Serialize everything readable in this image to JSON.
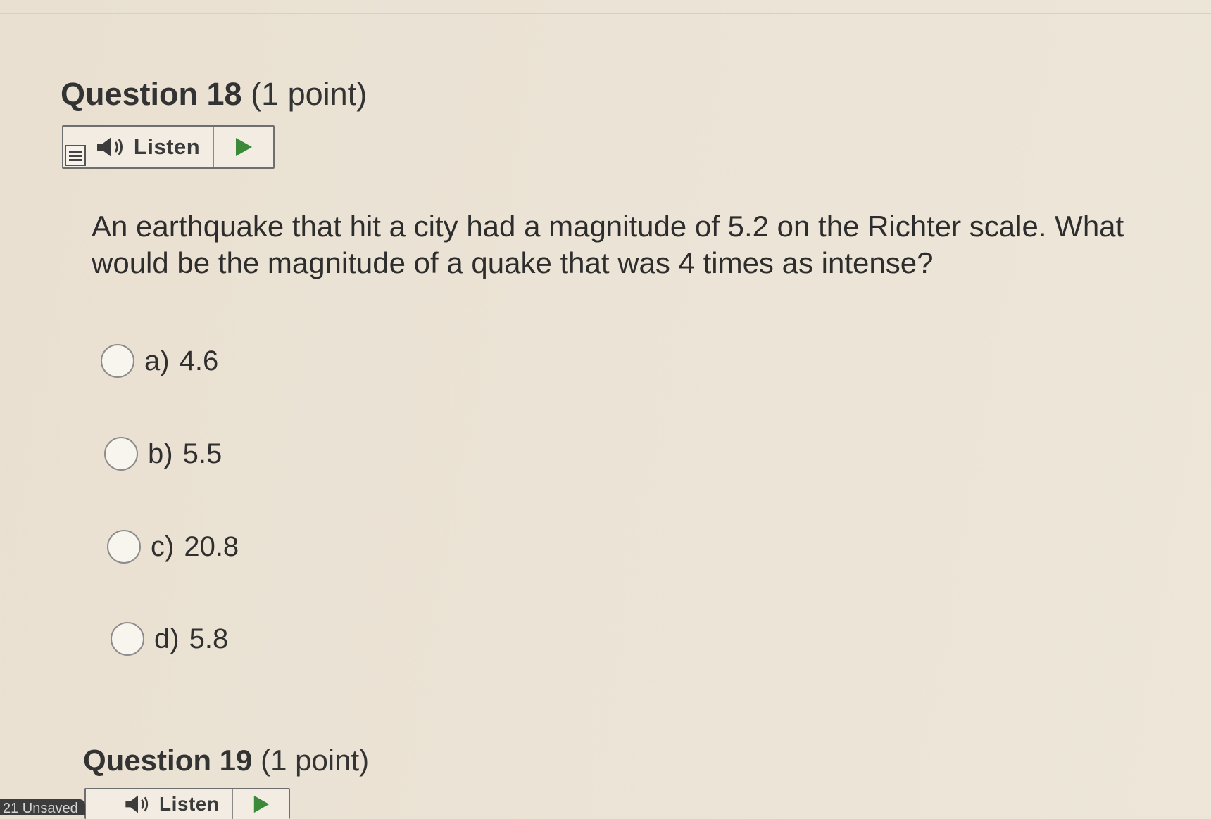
{
  "question18": {
    "number_label": "Question 18",
    "points_label": "(1 point)",
    "listen_label": "Listen",
    "prompt": "An earthquake that hit a city had a magnitude of 5.2 on the Richter scale. What would be the magnitude of a quake that was 4 times as intense?",
    "options": [
      {
        "letter": "a)",
        "value": "4.6"
      },
      {
        "letter": "b)",
        "value": "5.5"
      },
      {
        "letter": "c)",
        "value": "20.8"
      },
      {
        "letter": "d)",
        "value": "5.8"
      }
    ]
  },
  "question19": {
    "number_label": "Question 19",
    "points_label": "(1 point)",
    "listen_label": "Listen"
  },
  "bottom_tab": {
    "label": "21 Unsaved"
  },
  "colors": {
    "play_icon": "#3a8a3a",
    "speaker_icon": "#3c3c3c"
  }
}
